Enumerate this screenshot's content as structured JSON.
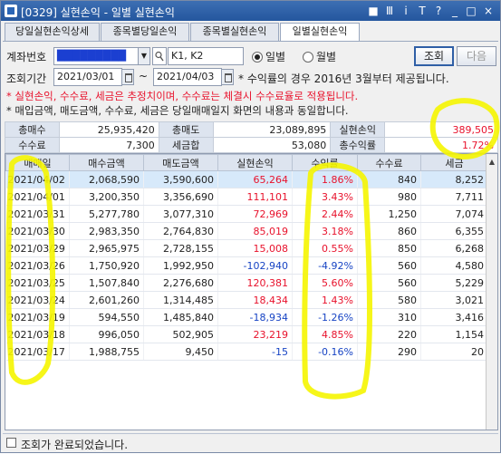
{
  "window": {
    "title": "[0329] 실현손익 - 일별 실현손익",
    "controls": [
      "■",
      "Ⅲ",
      "i",
      "T",
      "?",
      "_",
      "□",
      "×"
    ]
  },
  "tabs": [
    {
      "label": "당일실현손익상세",
      "active": false
    },
    {
      "label": "종목별당일손익",
      "active": false
    },
    {
      "label": "종목별실현손익",
      "active": false
    },
    {
      "label": "일별실현손익",
      "active": true
    }
  ],
  "filters": {
    "account_label": "계좌번호",
    "account_value": "█████████",
    "account_name": "K1, K2",
    "radio_daily": "일별",
    "radio_monthly": "월별",
    "search_button": "조회",
    "next_button": "다음",
    "period_label": "조회기간",
    "date_from": "2021/03/01",
    "date_sep": "~",
    "date_to": "2021/04/03",
    "period_note": "* 수익률의 경우 2016년 3월부터 제공됩니다."
  },
  "notes": {
    "red": "* 실현손익, 수수료, 세금은 추정치이며, 수수료는 체결시 수수료율로 적용됩니다.",
    "black": "* 매입금액, 매도금액, 수수료, 세금은 당일매매일지 화면의 내용과 동일합니다."
  },
  "summary": {
    "total_buy_label": "총매수",
    "total_buy": "25,935,420",
    "total_sell_label": "총매도",
    "total_sell": "23,089,895",
    "realized_label": "실현손익",
    "realized": "389,505",
    "fee_label": "수수료",
    "fee": "7,300",
    "tax_label": "세금합",
    "tax": "53,080",
    "return_label": "총수익률",
    "return": "1.72%"
  },
  "table": {
    "headers": [
      "매매일",
      "매수금액",
      "매도금액",
      "실현손익",
      "수익률",
      "수수료",
      "세금"
    ],
    "rows": [
      {
        "date": "2021/04/02",
        "buy": "2,068,590",
        "sell": "3,590,600",
        "pnl": "65,264",
        "rate": "1.86%",
        "fee": "840",
        "tax": "8,252",
        "sign": "pos"
      },
      {
        "date": "2021/04/01",
        "buy": "3,200,350",
        "sell": "3,356,690",
        "pnl": "111,101",
        "rate": "3.43%",
        "fee": "980",
        "tax": "7,711",
        "sign": "pos"
      },
      {
        "date": "2021/03/31",
        "buy": "5,277,780",
        "sell": "3,077,310",
        "pnl": "72,969",
        "rate": "2.44%",
        "fee": "1,250",
        "tax": "7,074",
        "sign": "pos"
      },
      {
        "date": "2021/03/30",
        "buy": "2,983,350",
        "sell": "2,764,830",
        "pnl": "85,019",
        "rate": "3.18%",
        "fee": "860",
        "tax": "6,355",
        "sign": "pos"
      },
      {
        "date": "2021/03/29",
        "buy": "2,965,975",
        "sell": "2,728,155",
        "pnl": "15,008",
        "rate": "0.55%",
        "fee": "850",
        "tax": "6,268",
        "sign": "pos"
      },
      {
        "date": "2021/03/26",
        "buy": "1,750,920",
        "sell": "1,992,950",
        "pnl": "-102,940",
        "rate": "-4.92%",
        "fee": "560",
        "tax": "4,580",
        "sign": "neg"
      },
      {
        "date": "2021/03/25",
        "buy": "1,507,840",
        "sell": "2,276,680",
        "pnl": "120,381",
        "rate": "5.60%",
        "fee": "560",
        "tax": "5,229",
        "sign": "pos"
      },
      {
        "date": "2021/03/24",
        "buy": "2,601,260",
        "sell": "1,314,485",
        "pnl": "18,434",
        "rate": "1.43%",
        "fee": "580",
        "tax": "3,021",
        "sign": "pos"
      },
      {
        "date": "2021/03/19",
        "buy": "594,550",
        "sell": "1,485,840",
        "pnl": "-18,934",
        "rate": "-1.26%",
        "fee": "310",
        "tax": "3,416",
        "sign": "neg"
      },
      {
        "date": "2021/03/18",
        "buy": "996,050",
        "sell": "502,905",
        "pnl": "23,219",
        "rate": "4.85%",
        "fee": "220",
        "tax": "1,154",
        "sign": "pos"
      },
      {
        "date": "2021/03/17",
        "buy": "1,988,755",
        "sell": "9,450",
        "pnl": "-15",
        "rate": "-0.16%",
        "fee": "290",
        "tax": "20",
        "sign": "neg"
      }
    ]
  },
  "status": {
    "text": "조회가 완료되었습니다."
  },
  "colors": {
    "positive": "#e8122c",
    "negative": "#1744c4",
    "highlighter": "#f5f500",
    "selected_row": "#d7e9fa"
  }
}
